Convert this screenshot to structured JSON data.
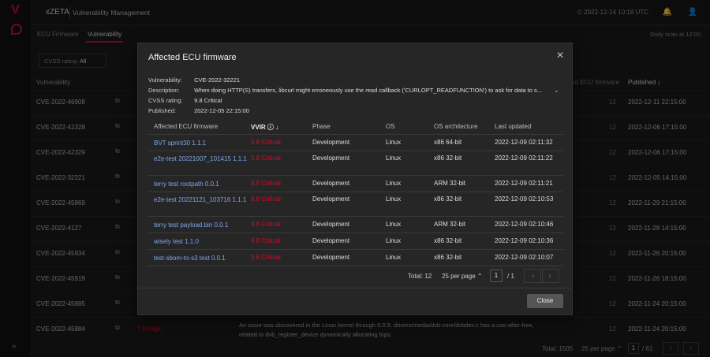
{
  "rail": {
    "logo": "V",
    "expand": "»"
  },
  "topbar": {
    "brand": "xZETA",
    "app_title": "Vulnerability Management",
    "clock": "⏲ 2022-12-14 10:18 UTC",
    "bell": "🔔",
    "user": "👤"
  },
  "tabs": [
    "ECU Firmware",
    "Vulnerability"
  ],
  "daily_scan": "Daily scan at 12:00",
  "filter": {
    "label": "CVSS rating:",
    "value": "All"
  },
  "bg_table": {
    "headers": [
      "Vulnerability",
      "ed ECU firmware",
      "Published ↓"
    ],
    "rows": [
      {
        "cve": "CVE-2022-46908",
        "count": "12",
        "published": "2022-12-11 22:15:00"
      },
      {
        "cve": "CVE-2022-42328",
        "count": "12",
        "published": "2022-12-06 17:15:00"
      },
      {
        "cve": "CVE-2022-42329",
        "count": "12",
        "published": "2022-12-06 17:15:00"
      },
      {
        "cve": "CVE-2022-32221",
        "count": "12",
        "published": "2022-12-05 14:15:00"
      },
      {
        "cve": "CVE-2022-45869",
        "count": "12",
        "published": "2022-11-29 21:15:00"
      },
      {
        "cve": "CVE-2022-4127",
        "count": "12",
        "published": "2022-11-28 14:15:00"
      },
      {
        "cve": "CVE-2022-45934",
        "count": "12",
        "published": "2022-11-26 20:15:00"
      },
      {
        "cve": "CVE-2022-45919",
        "count": "12",
        "published": "2022-11-26 18:15:00"
      },
      {
        "cve": "CVE-2022-45885",
        "count": "12",
        "published": "2022-11-24 20:15:00"
      },
      {
        "cve": "CVE-2022-45884",
        "severity": "7.0 High",
        "description": "An issue was discovered in the Linux kernel through 6.0.9. drivers/media/dvb-core/dvbdev.c has a use-after-free, related to dvb_register_device dynamically allocating fops.",
        "count": "12",
        "published": "2022-11-24 20:15:00"
      }
    ],
    "footer": {
      "total": "Total: 1505",
      "per_page": "25 per page ⌃",
      "page": "1",
      "of": "/ 61",
      "prev": "‹",
      "next": "›"
    }
  },
  "modal": {
    "title": "Affected ECU firmware",
    "close_icon": "✕",
    "meta": {
      "vulnerability_label": "Vulnerability:",
      "vulnerability": "CVE-2022-32221",
      "description_label": "Description:",
      "description": "When doing HTTP(S) transfers, libcurl might erroneously use the read callback ('CURLOPT_READFUNCTION') to ask for data to s...",
      "cvss_label": "CVSS rating:",
      "cvss": "9.8 Critical",
      "published_label": "Published:",
      "published": "2022-12-05 22:15:00"
    },
    "columns": [
      "Affected ECU firmware",
      "VVIR ⓘ ↓",
      "Phase",
      "OS",
      "OS architecture",
      "Last updated"
    ],
    "rows": [
      {
        "name": "BVT sprint30 1.1.1",
        "vvir": "9.8 Critical",
        "phase": "Development",
        "os": "Linux",
        "arch": "x86 64-bit",
        "updated": "2022-12-09 02:11:32"
      },
      {
        "name": "e2e-test 20221007_101415 1.1.1",
        "vvir": "9.8 Critical",
        "phase": "Development",
        "os": "Linux",
        "arch": "x86 32-bit",
        "updated": "2022-12-09 02:11:22"
      },
      {
        "name": "terry test rootpath 0.0.1",
        "vvir": "9.8 Critical",
        "phase": "Development",
        "os": "Linux",
        "arch": "ARM 32-bit",
        "updated": "2022-12-09 02:11:21"
      },
      {
        "name": "e2e-test 20221121_103716 1.1.1",
        "vvir": "9.8 Critical",
        "phase": "Development",
        "os": "Linux",
        "arch": "x86 32-bit",
        "updated": "2022-12-09 02:10:53"
      },
      {
        "name": "terry test payload.bin 0.0.1",
        "vvir": "9.8 Critical",
        "phase": "Development",
        "os": "Linux",
        "arch": "ARM 32-bit",
        "updated": "2022-12-09 02:10:46"
      },
      {
        "name": "wisely test 1.1.0",
        "vvir": "9.8 Critical",
        "phase": "Development",
        "os": "Linux",
        "arch": "x86 32-bit",
        "updated": "2022-12-09 02:10:36"
      },
      {
        "name": "test-sbom-to-s3 test 0.0.1",
        "vvir": "9.8 Critical",
        "phase": "Development",
        "os": "Linux",
        "arch": "x86 32-bit",
        "updated": "2022-12-09 02:10:07"
      }
    ],
    "pagination": {
      "total": "Total: 12",
      "per_page": "25 per page ⌃",
      "page": "1",
      "of": "/ 1",
      "prev": "‹",
      "next": "›"
    },
    "close_label": "Close"
  }
}
